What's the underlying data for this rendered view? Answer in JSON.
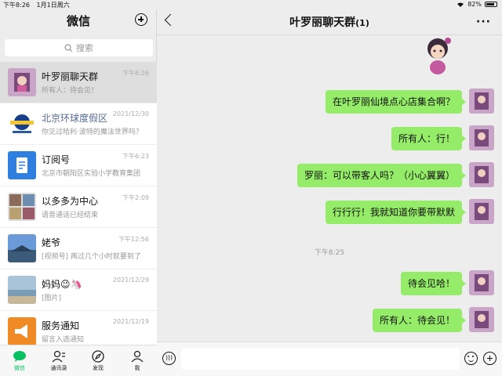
{
  "status": {
    "time": "下午8:26",
    "date": "1月1日周六",
    "battery": "82%"
  },
  "sidebar": {
    "title": "微信",
    "search_placeholder": "搜索",
    "chats": [
      {
        "name": "叶罗丽聊天群",
        "time": "下午8:26",
        "preview": "所有人：待会见！",
        "active": true,
        "avatar": "fairy"
      },
      {
        "name": "北京环球度假区",
        "time": "2021/12/30",
        "preview": "你见过哈利·波特的魔法世界吗？",
        "avatar": "globe"
      },
      {
        "name": "订阅号",
        "time": "下午6:23",
        "preview": "北京市朝阳区实验小学教育集团",
        "avatar": "doc"
      },
      {
        "name": "以多多为中心",
        "time": "下午2:09",
        "preview": "语音通话已经结束",
        "avatar": "photos"
      },
      {
        "name": "姥爷",
        "time": "下午12:56",
        "preview": "[视频号] 再过几个小时就要到了",
        "avatar": "sky"
      },
      {
        "name": "妈妈😉🦄",
        "time": "2021/12/29",
        "preview": "[图片]",
        "avatar": "beach"
      },
      {
        "name": "服务通知",
        "time": "2021/12/19",
        "preview": "留言入选通知",
        "avatar": "notice"
      }
    ],
    "tabs": [
      {
        "label": "微信",
        "icon": "chat-icon",
        "active": true
      },
      {
        "label": "通讯录",
        "icon": "contacts-icon"
      },
      {
        "label": "发现",
        "icon": "compass-icon"
      },
      {
        "label": "我",
        "icon": "me-icon"
      }
    ]
  },
  "chat": {
    "title": "叶罗丽聊天群",
    "member_count": "(1)",
    "timestamp": "下午8:25",
    "messages": [
      {
        "text": "在叶罗丽仙境点心店集合啊？"
      },
      {
        "text": "所有人：行！"
      },
      {
        "text": "罗丽：可以带客人吗？（小心翼翼）"
      },
      {
        "text": "行行行！我就知道你要带默默"
      },
      {
        "text": "待会见哈！"
      },
      {
        "text": "所有人：待会见！"
      }
    ]
  },
  "colors": {
    "bubble": "#95ec69",
    "accent": "#07c160",
    "sidebar_bg": "#ededed"
  }
}
